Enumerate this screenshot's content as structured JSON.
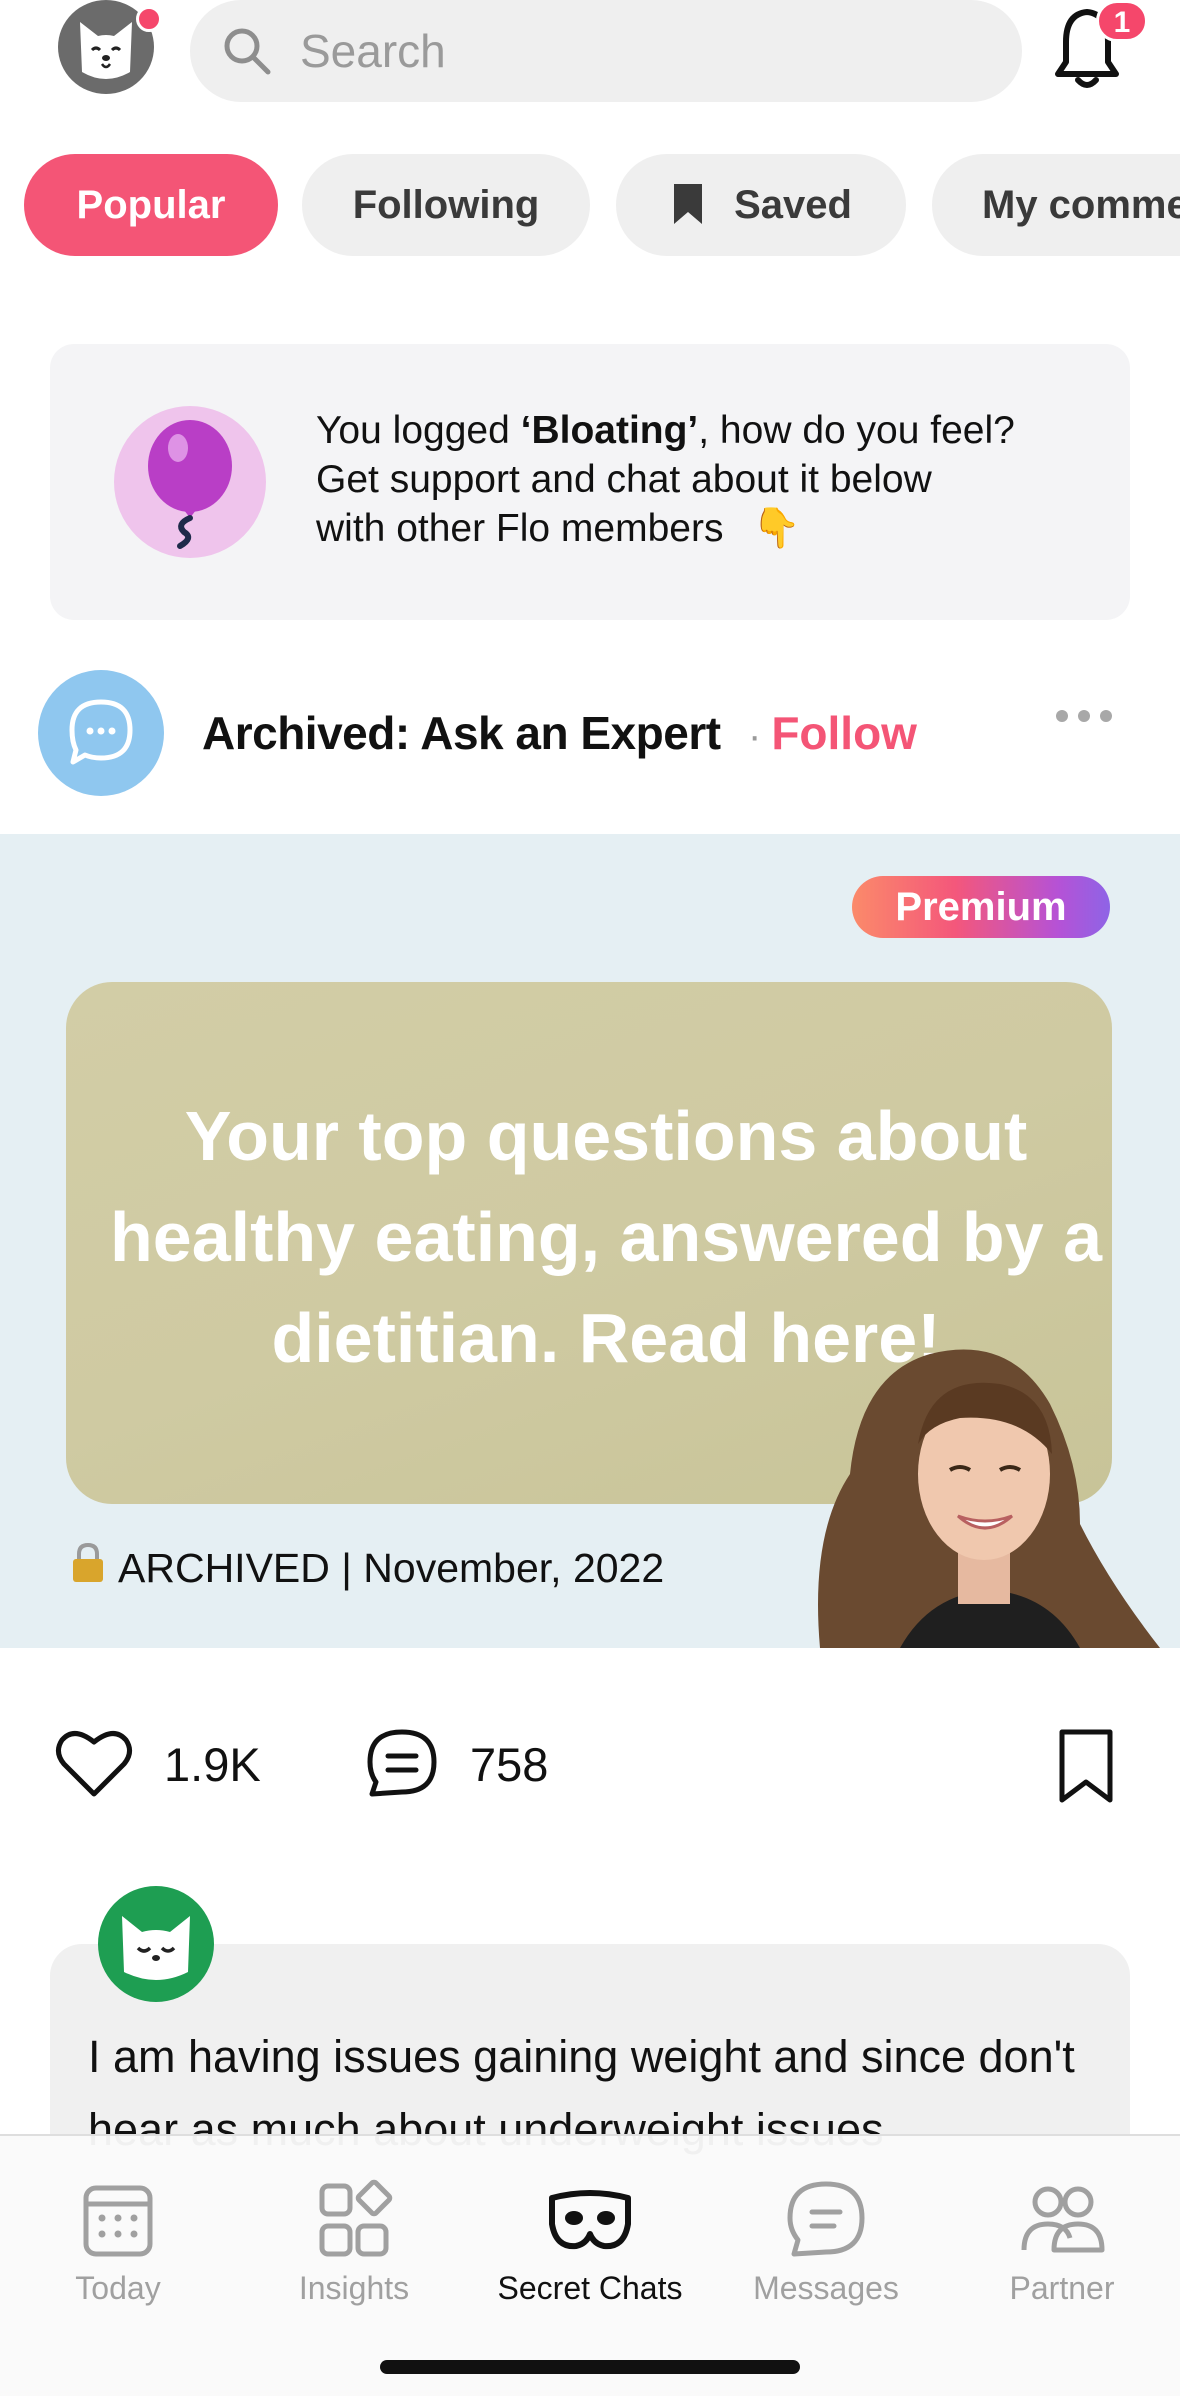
{
  "header": {
    "search_placeholder": "Search",
    "notification_count": "1"
  },
  "filters": [
    {
      "label": "Popular",
      "active": true
    },
    {
      "label": "Following",
      "active": false
    },
    {
      "label": "Saved",
      "active": false
    },
    {
      "label": "My comme",
      "active": false
    }
  ],
  "banner": {
    "line_prefix": "You logged ",
    "symptom": "‘Bloating’",
    "line_suffix": ", how do you feel?",
    "line2": "Get support and chat about it below",
    "line3": "with other Flo members",
    "emoji": "👇"
  },
  "post": {
    "title": "Archived: Ask an Expert",
    "separator": "·",
    "follow_label": "Follow",
    "badge": "Premium",
    "card_text": "Your top questions about healthy eating, answered by a dietitian. Read here!",
    "archived_text": "ARCHIVED | November, 2022",
    "likes": "1.9K",
    "comments": "758"
  },
  "comment": {
    "text": "I am having issues gaining weight and since don't hear as much about underweight issues"
  },
  "tabbar": [
    {
      "label": "Today",
      "active": false
    },
    {
      "label": "Insights",
      "active": false
    },
    {
      "label": "Secret Chats",
      "active": true
    },
    {
      "label": "Messages",
      "active": false
    },
    {
      "label": "Partner",
      "active": false
    }
  ],
  "colors": {
    "accent": "#f45576",
    "hero_bg": "#e5eff3",
    "card_bg": "#d0cba3",
    "tab_inactive": "#a0a0a0"
  }
}
